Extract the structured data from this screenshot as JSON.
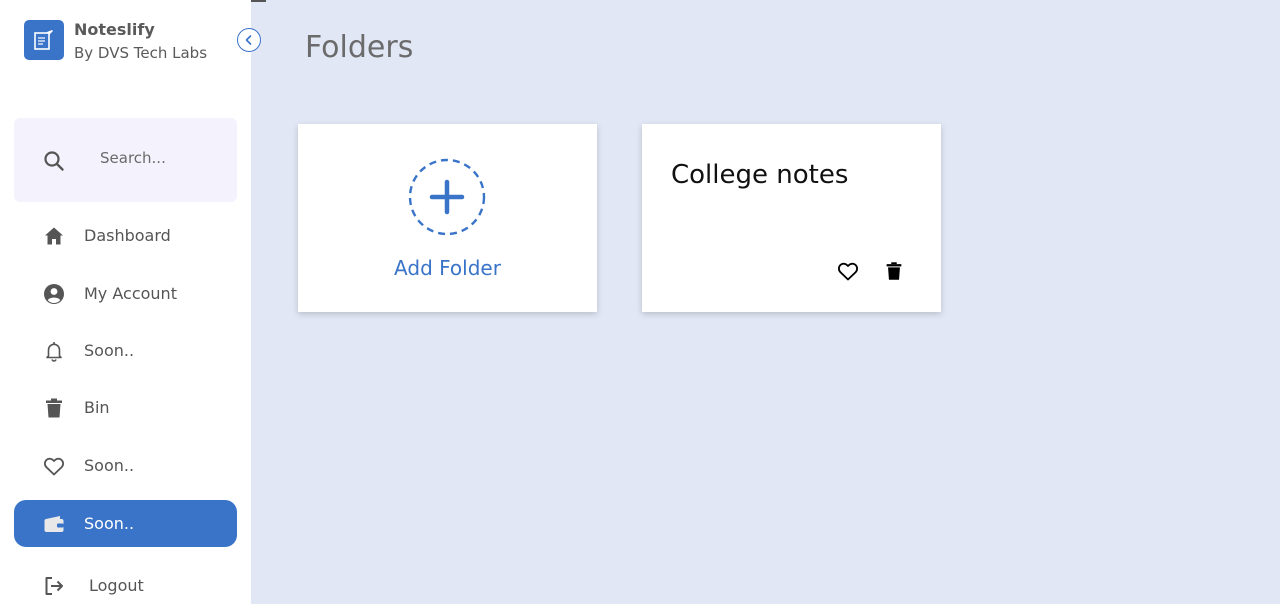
{
  "app": {
    "name": "Noteslify",
    "subtitle": "By DVS Tech Labs"
  },
  "search": {
    "placeholder": "Search..."
  },
  "sidebar": {
    "items": [
      {
        "label": "Dashboard",
        "icon": "home-icon"
      },
      {
        "label": "My Account",
        "icon": "account-icon"
      },
      {
        "label": "Soon..",
        "icon": "bell-icon"
      },
      {
        "label": "Bin",
        "icon": "trash-icon"
      },
      {
        "label": "Soon..",
        "icon": "heart-icon"
      },
      {
        "label": "Soon..",
        "icon": "wallet-icon",
        "active": true
      },
      {
        "label": "Logout",
        "icon": "logout-icon"
      }
    ]
  },
  "main": {
    "title": "Folders",
    "add_folder_label": "Add Folder",
    "folders": [
      {
        "name": "College notes"
      }
    ]
  },
  "colors": {
    "accent": "#3a74c9",
    "background": "#e1e7f5",
    "sidebar_bg": "#ffffff",
    "search_bg": "#f4f3fd"
  }
}
